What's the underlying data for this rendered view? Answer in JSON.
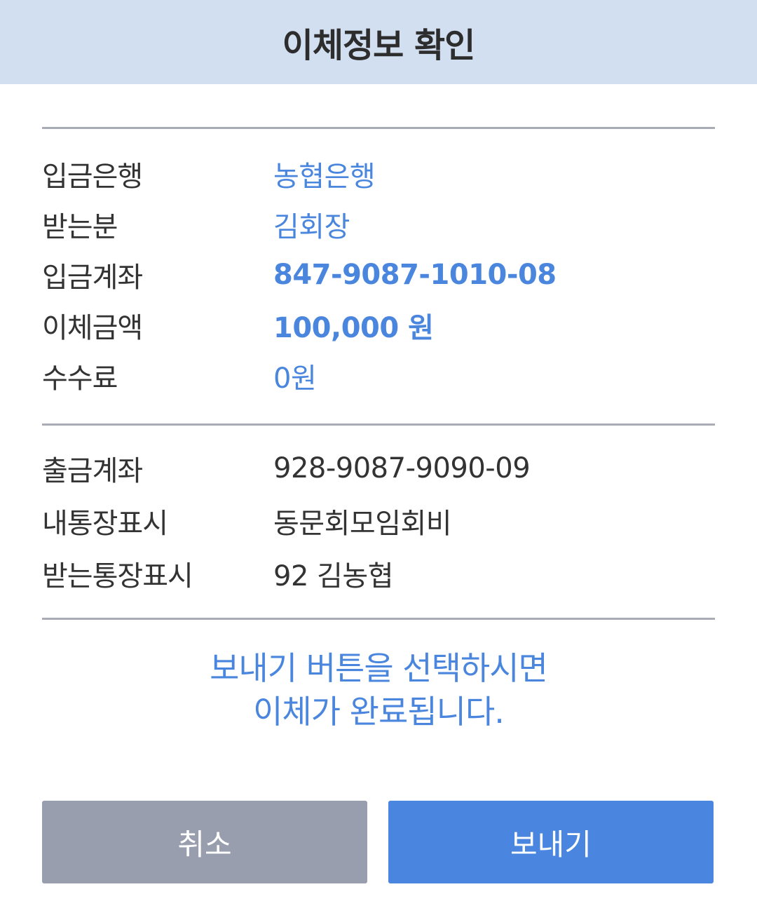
{
  "header": {
    "title": "이체정보 확인"
  },
  "deposit_info": [
    {
      "label": "입금은행",
      "value": "농협은행"
    },
    {
      "label": "받는분",
      "value": "김회장"
    },
    {
      "label": "입금계좌",
      "value": "847-9087-1010-08"
    },
    {
      "label": "이체금액",
      "value": "100,000 원"
    },
    {
      "label": "수수료",
      "value": "0원"
    }
  ],
  "withdraw_info": [
    {
      "label": "출금계좌",
      "value": "928-9087-9090-09"
    },
    {
      "label": "내통장표시",
      "value": "동문회모임회비"
    },
    {
      "label": "받는통장표시",
      "value": "92 김농협"
    }
  ],
  "notice": {
    "line1": "보내기 버튼을 선택하시면",
    "line2": "이체가 완료됩니다."
  },
  "buttons": {
    "cancel_label": "취소",
    "send_label": "보내기"
  },
  "colors": {
    "header_bg": "#d2dff1",
    "accent": "#4a86dd",
    "cancel_bg": "#989ead",
    "send_bg": "#4a86e0"
  }
}
